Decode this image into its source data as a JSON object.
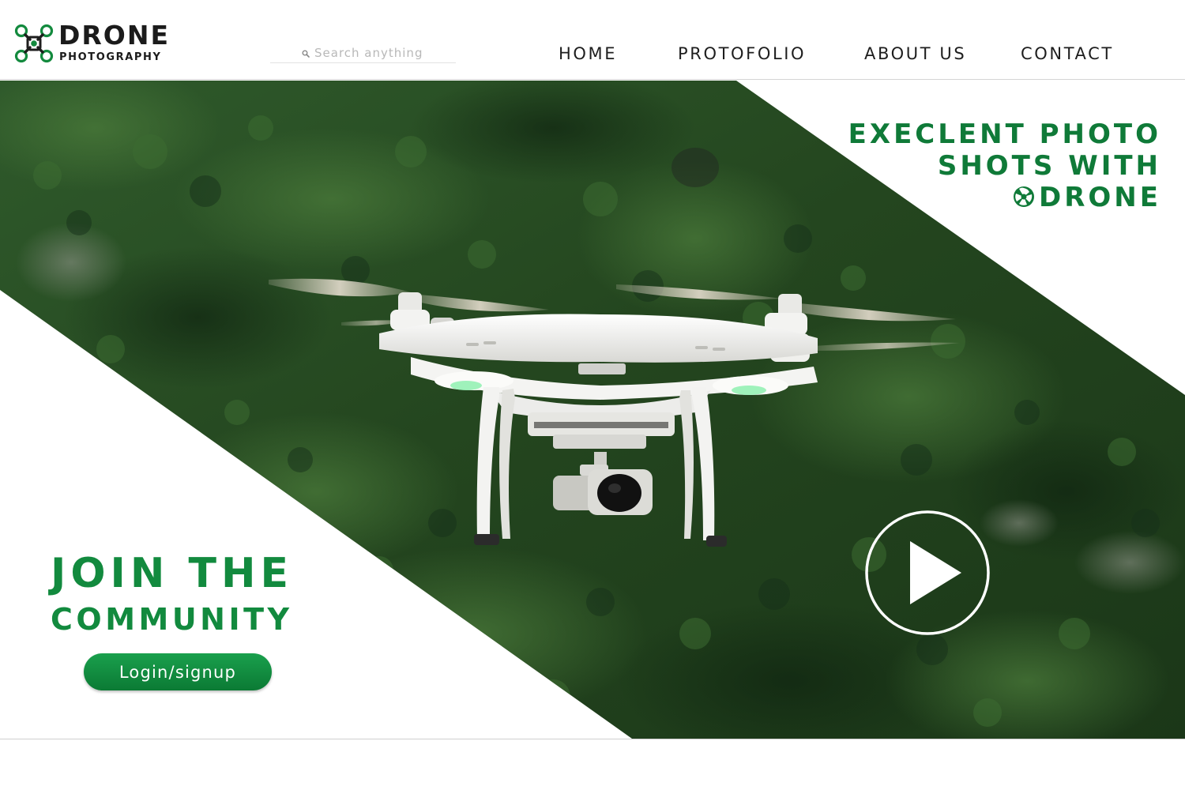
{
  "brand": {
    "title": "DRONE",
    "subtitle": "PHOTOGRAPHY",
    "icon": "drone-icon"
  },
  "search": {
    "placeholder": "Search anything",
    "value": "",
    "icon": "search-icon"
  },
  "nav": {
    "items": [
      {
        "label": "HOME"
      },
      {
        "label": "PROTOFOLIO"
      },
      {
        "label": "ABOUT US"
      },
      {
        "label": "CONTACT"
      }
    ]
  },
  "hero": {
    "tagline_line1": "EXECLENT PHOTO",
    "tagline_line2": "SHOTS WITH",
    "tagline_line3": "DRONE",
    "tagline_icon": "aperture-icon",
    "join_line1": "JOIN THE",
    "join_line2": "COMMUNITY",
    "login_label": "Login/signup",
    "play_icon": "play-icon"
  },
  "colors": {
    "brand_green": "#128a3e",
    "button_green": "#0b7a34",
    "text_dark": "#1e1e1e",
    "forest_dark": "#1f3d1c"
  }
}
